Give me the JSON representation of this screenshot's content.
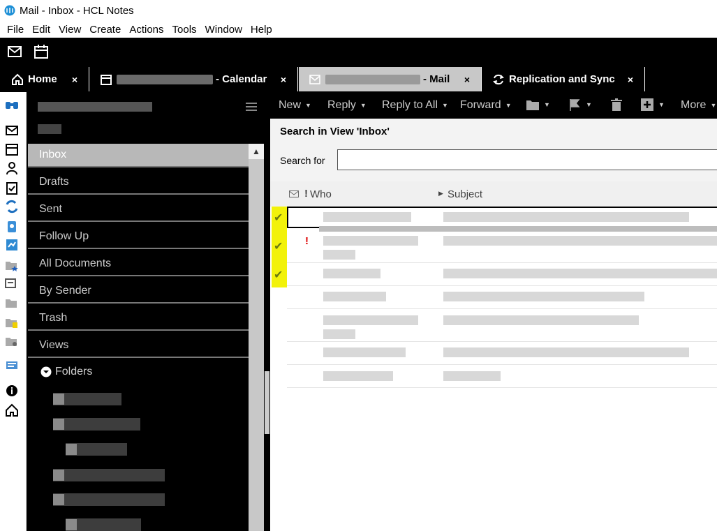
{
  "window": {
    "title": "Mail - Inbox - HCL Notes"
  },
  "menu": [
    "File",
    "Edit",
    "View",
    "Create",
    "Actions",
    "Tools",
    "Window",
    "Help"
  ],
  "tabs": [
    {
      "label": "Home",
      "close": "×"
    },
    {
      "label": "- Calendar",
      "close": "×"
    },
    {
      "label": "- Mail",
      "close": "×"
    },
    {
      "label": "Replication and Sync",
      "close": "×"
    }
  ],
  "sidebar": {
    "nav": [
      {
        "label": "Inbox",
        "selected": true
      },
      {
        "label": "Drafts"
      },
      {
        "label": "Sent"
      },
      {
        "label": "Follow Up"
      },
      {
        "label": "All Documents"
      },
      {
        "label": "By Sender"
      },
      {
        "label": "Trash"
      },
      {
        "label": "Views"
      }
    ],
    "folders_label": "Folders"
  },
  "actions": {
    "new": "New",
    "reply": "Reply",
    "reply_all": "Reply to All",
    "forward": "Forward",
    "more": "More"
  },
  "search": {
    "title": "Search in View 'Inbox'",
    "label": "Search for",
    "value": ""
  },
  "columns": {
    "importance": "!",
    "who": "Who",
    "subject": "Subject"
  },
  "rows_info": {
    "replied_rows": 3,
    "important_mark": "!"
  },
  "colors": {
    "accent_yellow": "#f2f20a",
    "toolbar_bg": "#000000",
    "selected_nav": "#b8b8b8"
  }
}
